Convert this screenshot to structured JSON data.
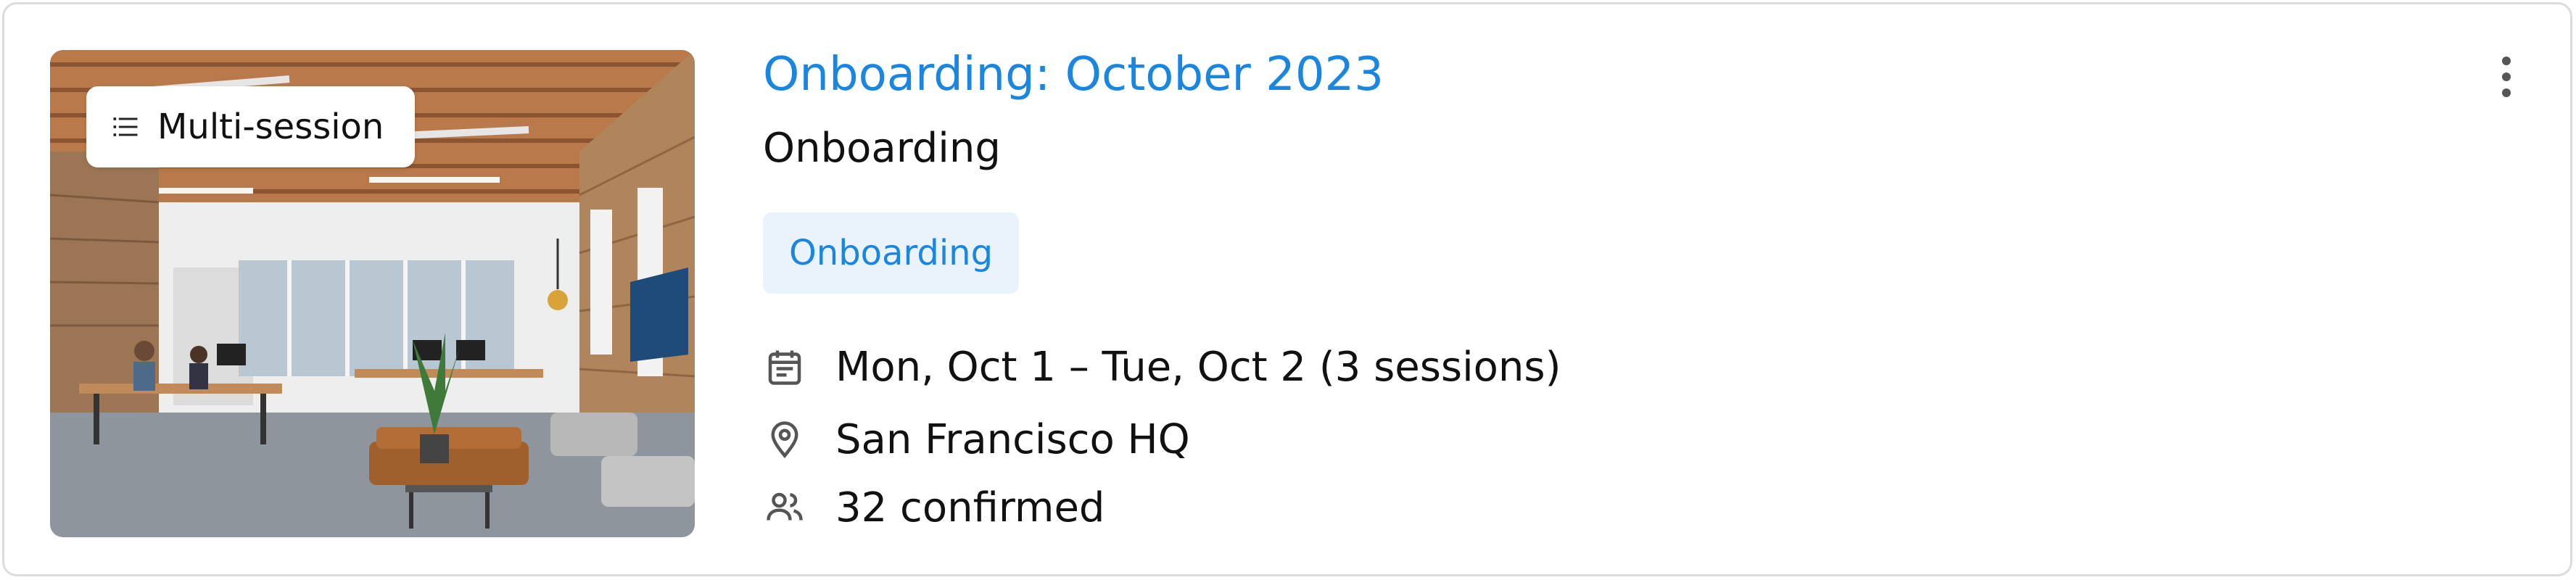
{
  "card": {
    "badge_label": "Multi-session",
    "title": "Onboarding: October 2023",
    "subtitle": "Onboarding",
    "tag": "Onboarding",
    "date_text": "Mon, Oct 1 – Tue, Oct 2 (3 sessions)",
    "location_text": "San Francisco HQ",
    "attendees_text": "32 confirmed"
  },
  "icons": {
    "badge": "list-icon",
    "date": "calendar-icon",
    "location": "location-pin-icon",
    "attendees": "people-icon",
    "menu": "more-vertical-icon"
  },
  "colors": {
    "accent": "#1a86e0",
    "tag_background": "#eaf3fc",
    "text": "#111111",
    "icon": "#555555",
    "border": "#dcdcdc"
  }
}
